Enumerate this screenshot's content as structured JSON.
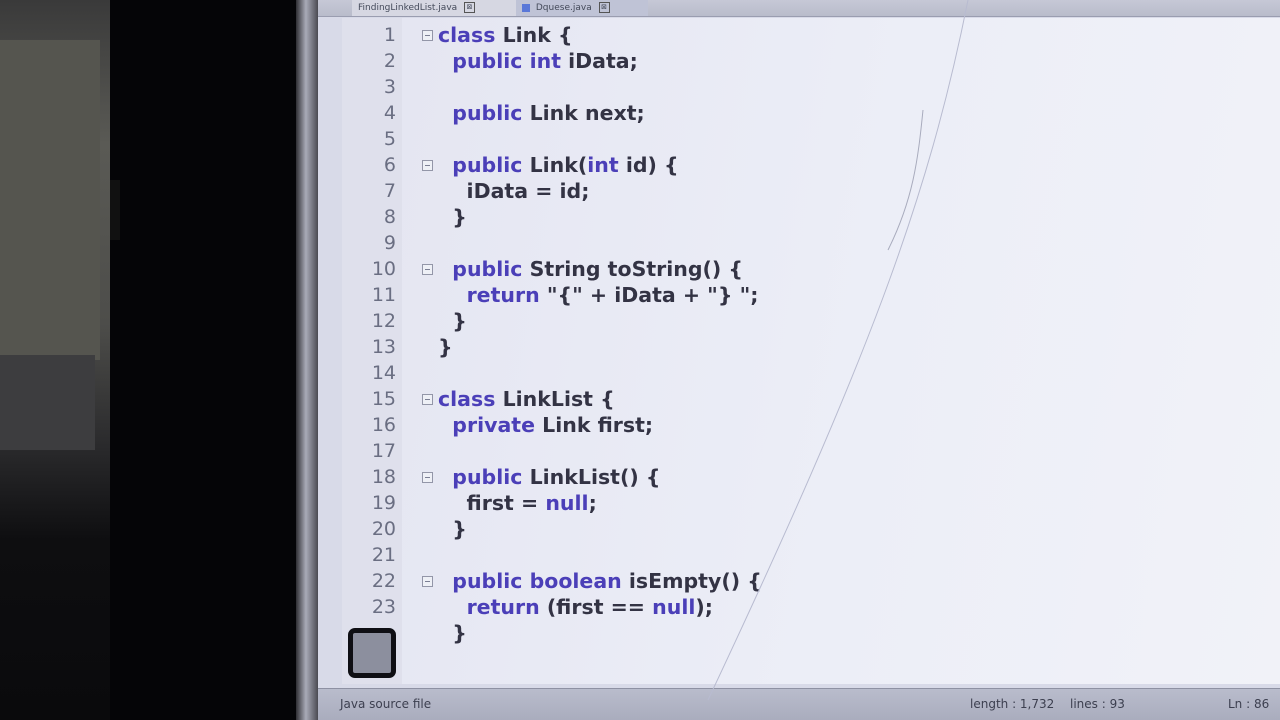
{
  "tabs": [
    {
      "label": "FindingLinkedList.java",
      "close": "⊠"
    },
    {
      "label": "Dquese.java",
      "close": "⊠"
    }
  ],
  "editor": {
    "lines": [
      {
        "num": "1",
        "tokens": [
          {
            "t": "class ",
            "k": true
          },
          {
            "t": "Link {",
            "k": false
          }
        ]
      },
      {
        "num": "2",
        "tokens": [
          {
            "t": "  ",
            "k": false
          },
          {
            "t": "public int ",
            "k": true
          },
          {
            "t": "iData;",
            "k": false
          }
        ]
      },
      {
        "num": "3",
        "tokens": []
      },
      {
        "num": "4",
        "tokens": [
          {
            "t": "  ",
            "k": false
          },
          {
            "t": "public ",
            "k": true
          },
          {
            "t": "Link next;",
            "k": false
          }
        ]
      },
      {
        "num": "5",
        "tokens": []
      },
      {
        "num": "6",
        "tokens": [
          {
            "t": "  ",
            "k": false
          },
          {
            "t": "public ",
            "k": true
          },
          {
            "t": "Link(",
            "k": false
          },
          {
            "t": "int",
            "k": true
          },
          {
            "t": " id) {",
            "k": false
          }
        ]
      },
      {
        "num": "7",
        "tokens": [
          {
            "t": "    iData = id;",
            "k": false
          }
        ]
      },
      {
        "num": "8",
        "tokens": [
          {
            "t": "  }",
            "k": false
          }
        ]
      },
      {
        "num": "9",
        "tokens": []
      },
      {
        "num": "10",
        "tokens": [
          {
            "t": "  ",
            "k": false
          },
          {
            "t": "public ",
            "k": true
          },
          {
            "t": "String toString() {",
            "k": false
          }
        ]
      },
      {
        "num": "11",
        "tokens": [
          {
            "t": "    ",
            "k": false
          },
          {
            "t": "return ",
            "k": true
          },
          {
            "t": "\"{\" + iData + \"} \";",
            "k": false
          }
        ]
      },
      {
        "num": "12",
        "tokens": [
          {
            "t": "  }",
            "k": false
          }
        ]
      },
      {
        "num": "13",
        "tokens": [
          {
            "t": "}",
            "k": false
          }
        ]
      },
      {
        "num": "14",
        "tokens": []
      },
      {
        "num": "15",
        "tokens": [
          {
            "t": "class ",
            "k": true
          },
          {
            "t": "LinkList {",
            "k": false
          }
        ]
      },
      {
        "num": "16",
        "tokens": [
          {
            "t": "  ",
            "k": false
          },
          {
            "t": "private ",
            "k": true
          },
          {
            "t": "Link first;",
            "k": false
          }
        ]
      },
      {
        "num": "17",
        "tokens": []
      },
      {
        "num": "18",
        "tokens": [
          {
            "t": "  ",
            "k": false
          },
          {
            "t": "public ",
            "k": true
          },
          {
            "t": "LinkList() {",
            "k": false
          }
        ]
      },
      {
        "num": "19",
        "tokens": [
          {
            "t": "    first = ",
            "k": false
          },
          {
            "t": "null",
            "k": true
          },
          {
            "t": ";",
            "k": false
          }
        ]
      },
      {
        "num": "20",
        "tokens": [
          {
            "t": "  }",
            "k": false
          }
        ]
      },
      {
        "num": "21",
        "tokens": []
      },
      {
        "num": "22",
        "tokens": [
          {
            "t": "  ",
            "k": false
          },
          {
            "t": "public boolean ",
            "k": true
          },
          {
            "t": "isEmpty() {",
            "k": false
          }
        ]
      },
      {
        "num": "23",
        "tokens": [
          {
            "t": "    ",
            "k": false
          },
          {
            "t": "return ",
            "k": true
          },
          {
            "t": "(first == ",
            "k": false
          },
          {
            "t": "null",
            "k": true
          },
          {
            "t": ");",
            "k": false
          }
        ]
      },
      {
        "num": "",
        "tokens": [
          {
            "t": "  }",
            "k": false
          }
        ]
      }
    ],
    "fold_lines": [
      "1",
      "6",
      "10",
      "15",
      "18",
      "22"
    ]
  },
  "status": {
    "file_type": "Java source file",
    "length": "length : 1,732",
    "lines": "lines : 93",
    "position": "Ln : 86"
  },
  "colors": {
    "keyword": "#4b3fb8",
    "text": "#333344",
    "line_number": "#6a6e82",
    "editor_bg": "#eceef7"
  }
}
